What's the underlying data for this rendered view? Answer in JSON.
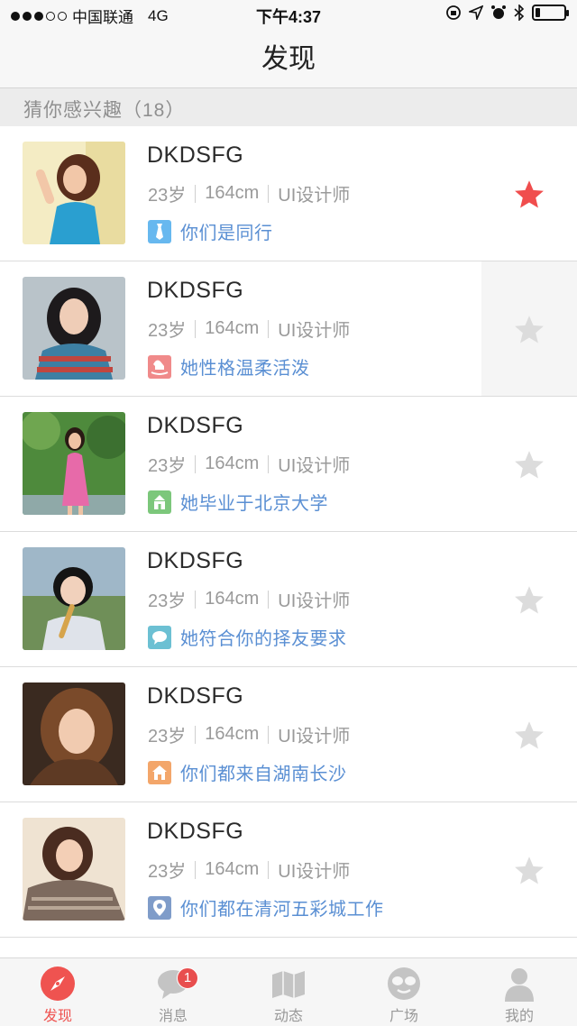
{
  "status_bar": {
    "carrier": "中国联通",
    "network": "4G",
    "time": "下午4:37",
    "battery_level": 0.18
  },
  "nav": {
    "title": "发现"
  },
  "section": {
    "title": "猜你感兴趣（18）"
  },
  "colors": {
    "accent": "#ef5350",
    "star_active": "#f04d4d",
    "star_inactive": "#dcdcdc",
    "tag_text": "#5a8fd3"
  },
  "people": [
    {
      "name": "DKDSFG",
      "age": "23岁",
      "height": "164cm",
      "job": "UI设计师",
      "tag": "你们是同行",
      "tag_icon": "tie-icon",
      "tag_color": "#67b8ef",
      "starred": true
    },
    {
      "name": "DKDSFG",
      "age": "23岁",
      "height": "164cm",
      "job": "UI设计师",
      "tag": "她性格温柔活泼",
      "tag_icon": "rocking-horse-icon",
      "tag_color": "#f08a8a",
      "starred": false
    },
    {
      "name": "DKDSFG",
      "age": "23岁",
      "height": "164cm",
      "job": "UI设计师",
      "tag": "她毕业于北京大学",
      "tag_icon": "school-icon",
      "tag_color": "#7cc77b",
      "starred": false
    },
    {
      "name": "DKDSFG",
      "age": "23岁",
      "height": "164cm",
      "job": "UI设计师",
      "tag": "她符合你的择友要求",
      "tag_icon": "chat-icon",
      "tag_color": "#6cc0d3",
      "starred": false
    },
    {
      "name": "DKDSFG",
      "age": "23岁",
      "height": "164cm",
      "job": "UI设计师",
      "tag": "你们都来自湖南长沙",
      "tag_icon": "home-icon",
      "tag_color": "#f3a66a",
      "starred": false
    },
    {
      "name": "DKDSFG",
      "age": "23岁",
      "height": "164cm",
      "job": "UI设计师",
      "tag": "你们都在清河五彩城工作",
      "tag_icon": "location-pin-icon",
      "tag_color": "#7f9cc9",
      "starred": false
    }
  ],
  "tabs": [
    {
      "label": "发现",
      "icon": "compass-icon",
      "active": true
    },
    {
      "label": "消息",
      "icon": "chat-bubble-icon",
      "badge": "1"
    },
    {
      "label": "动态",
      "icon": "map-icon"
    },
    {
      "label": "广场",
      "icon": "sunglasses-icon"
    },
    {
      "label": "我的",
      "icon": "user-icon"
    }
  ]
}
